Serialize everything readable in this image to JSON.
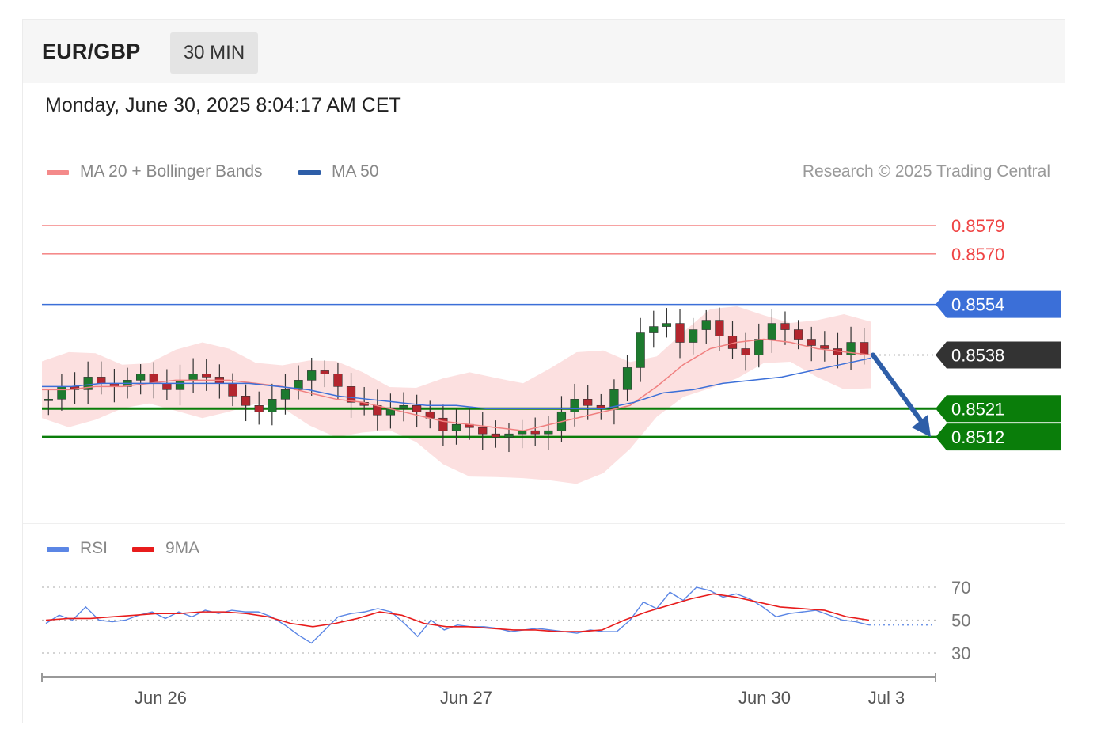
{
  "header": {
    "pair": "EUR/GBP",
    "timeframe": "30 MIN"
  },
  "date": "Monday, June 30, 2025 8:04:17 AM CET",
  "legend": {
    "ma20": "MA 20 + Bollinger Bands",
    "ma50": "MA 50",
    "credit": "Research © 2025 Trading Central"
  },
  "rsi_legend": {
    "rsi": "RSI",
    "ma9": "9MA"
  },
  "colors": {
    "resistance": "#ef4444",
    "ma50": "#3b6fd8",
    "support": "#0a7d0a",
    "bollinger": "#fbd0d0",
    "ma20": "#f08080",
    "current": "#333333",
    "rsi": "#5b86e5",
    "rsi_ma": "#e81c1c",
    "arrow": "#2e5ea8"
  },
  "chart_data": [
    {
      "type": "candlestick",
      "ylim": [
        0.8497,
        0.8584
      ],
      "x_tick_labels": [
        "Jun 26",
        "Jun 27",
        "Jun 30",
        "Jul 3"
      ],
      "levels": [
        {
          "label": "0.8579",
          "value": 0.8579,
          "kind": "resistance"
        },
        {
          "label": "0.8570",
          "value": 0.857,
          "kind": "resistance"
        },
        {
          "label": "0.8554",
          "value": 0.8554,
          "kind": "pivot"
        },
        {
          "label": "0.8538",
          "value": 0.8538,
          "kind": "current"
        },
        {
          "label": "0.8521",
          "value": 0.8521,
          "kind": "support"
        },
        {
          "label": "0.8512",
          "value": 0.8512,
          "kind": "support"
        }
      ],
      "price_path": [
        0.8524,
        0.8528,
        0.8527,
        0.8531,
        0.8529,
        0.8528,
        0.853,
        0.8532,
        0.8529,
        0.8527,
        0.853,
        0.8532,
        0.8531,
        0.8529,
        0.8525,
        0.8522,
        0.852,
        0.8524,
        0.8527,
        0.853,
        0.8533,
        0.8532,
        0.8528,
        0.8523,
        0.8522,
        0.8519,
        0.8521,
        0.8522,
        0.852,
        0.8518,
        0.8514,
        0.8516,
        0.8515,
        0.8513,
        0.8512,
        0.8513,
        0.8514,
        0.8513,
        0.8514,
        0.852,
        0.8524,
        0.8522,
        0.8521,
        0.8527,
        0.8534,
        0.8545,
        0.8547,
        0.8548,
        0.8542,
        0.8546,
        0.8549,
        0.8544,
        0.854,
        0.8538,
        0.8543,
        0.8548,
        0.8546,
        0.8543,
        0.8541,
        0.854,
        0.8538,
        0.8542,
        0.8538
      ],
      "ma20": [
        0.8527,
        0.8527,
        0.8528,
        0.8528,
        0.8529,
        0.853,
        0.853,
        0.853,
        0.8529,
        0.8528,
        0.8526,
        0.8524,
        0.8523,
        0.8521,
        0.8519,
        0.8517,
        0.8516,
        0.8515,
        0.8514,
        0.8516,
        0.8518,
        0.852,
        0.8522,
        0.8528,
        0.8535,
        0.854,
        0.8542,
        0.8543,
        0.8542,
        0.854,
        0.8539,
        0.8538
      ],
      "ma50": [
        0.8528,
        0.8528,
        0.8529,
        0.8529,
        0.8529,
        0.8529,
        0.8529,
        0.8529,
        0.8528,
        0.8527,
        0.8525,
        0.8524,
        0.8523,
        0.8522,
        0.8522,
        0.8521,
        0.8521,
        0.8521,
        0.8521,
        0.8521,
        0.8523,
        0.8526,
        0.8527,
        0.8529,
        0.853,
        0.8531,
        0.8533,
        0.8535,
        0.8537
      ]
    },
    {
      "type": "line",
      "name": "RSI",
      "ylim": [
        20,
        80
      ],
      "y_ticks": [
        {
          "label": "70",
          "value": 70
        },
        {
          "label": "50",
          "value": 50
        },
        {
          "label": "30",
          "value": 30
        }
      ],
      "series": [
        {
          "name": "RSI",
          "values": [
            48,
            53,
            50,
            58,
            50,
            49,
            50,
            53,
            55,
            51,
            55,
            52,
            56,
            54,
            56,
            55,
            55,
            52,
            47,
            41,
            36,
            44,
            52,
            54,
            55,
            57,
            55,
            48,
            40,
            50,
            44,
            47,
            46,
            46,
            45,
            43,
            44,
            45,
            44,
            43,
            42,
            44,
            43,
            43,
            50,
            61,
            57,
            67,
            62,
            70,
            68,
            64,
            66,
            63,
            58,
            52,
            54,
            55,
            56,
            53,
            50,
            49,
            47
          ]
        },
        {
          "name": "9MA",
          "values": [
            50,
            51,
            51,
            52,
            53,
            54,
            54,
            55,
            55,
            54,
            52,
            48,
            46,
            48,
            51,
            55,
            53,
            48,
            46,
            46,
            45,
            44,
            44,
            43,
            43,
            44,
            50,
            55,
            59,
            63,
            66,
            64,
            61,
            58,
            57,
            56,
            52,
            50
          ]
        }
      ]
    }
  ]
}
